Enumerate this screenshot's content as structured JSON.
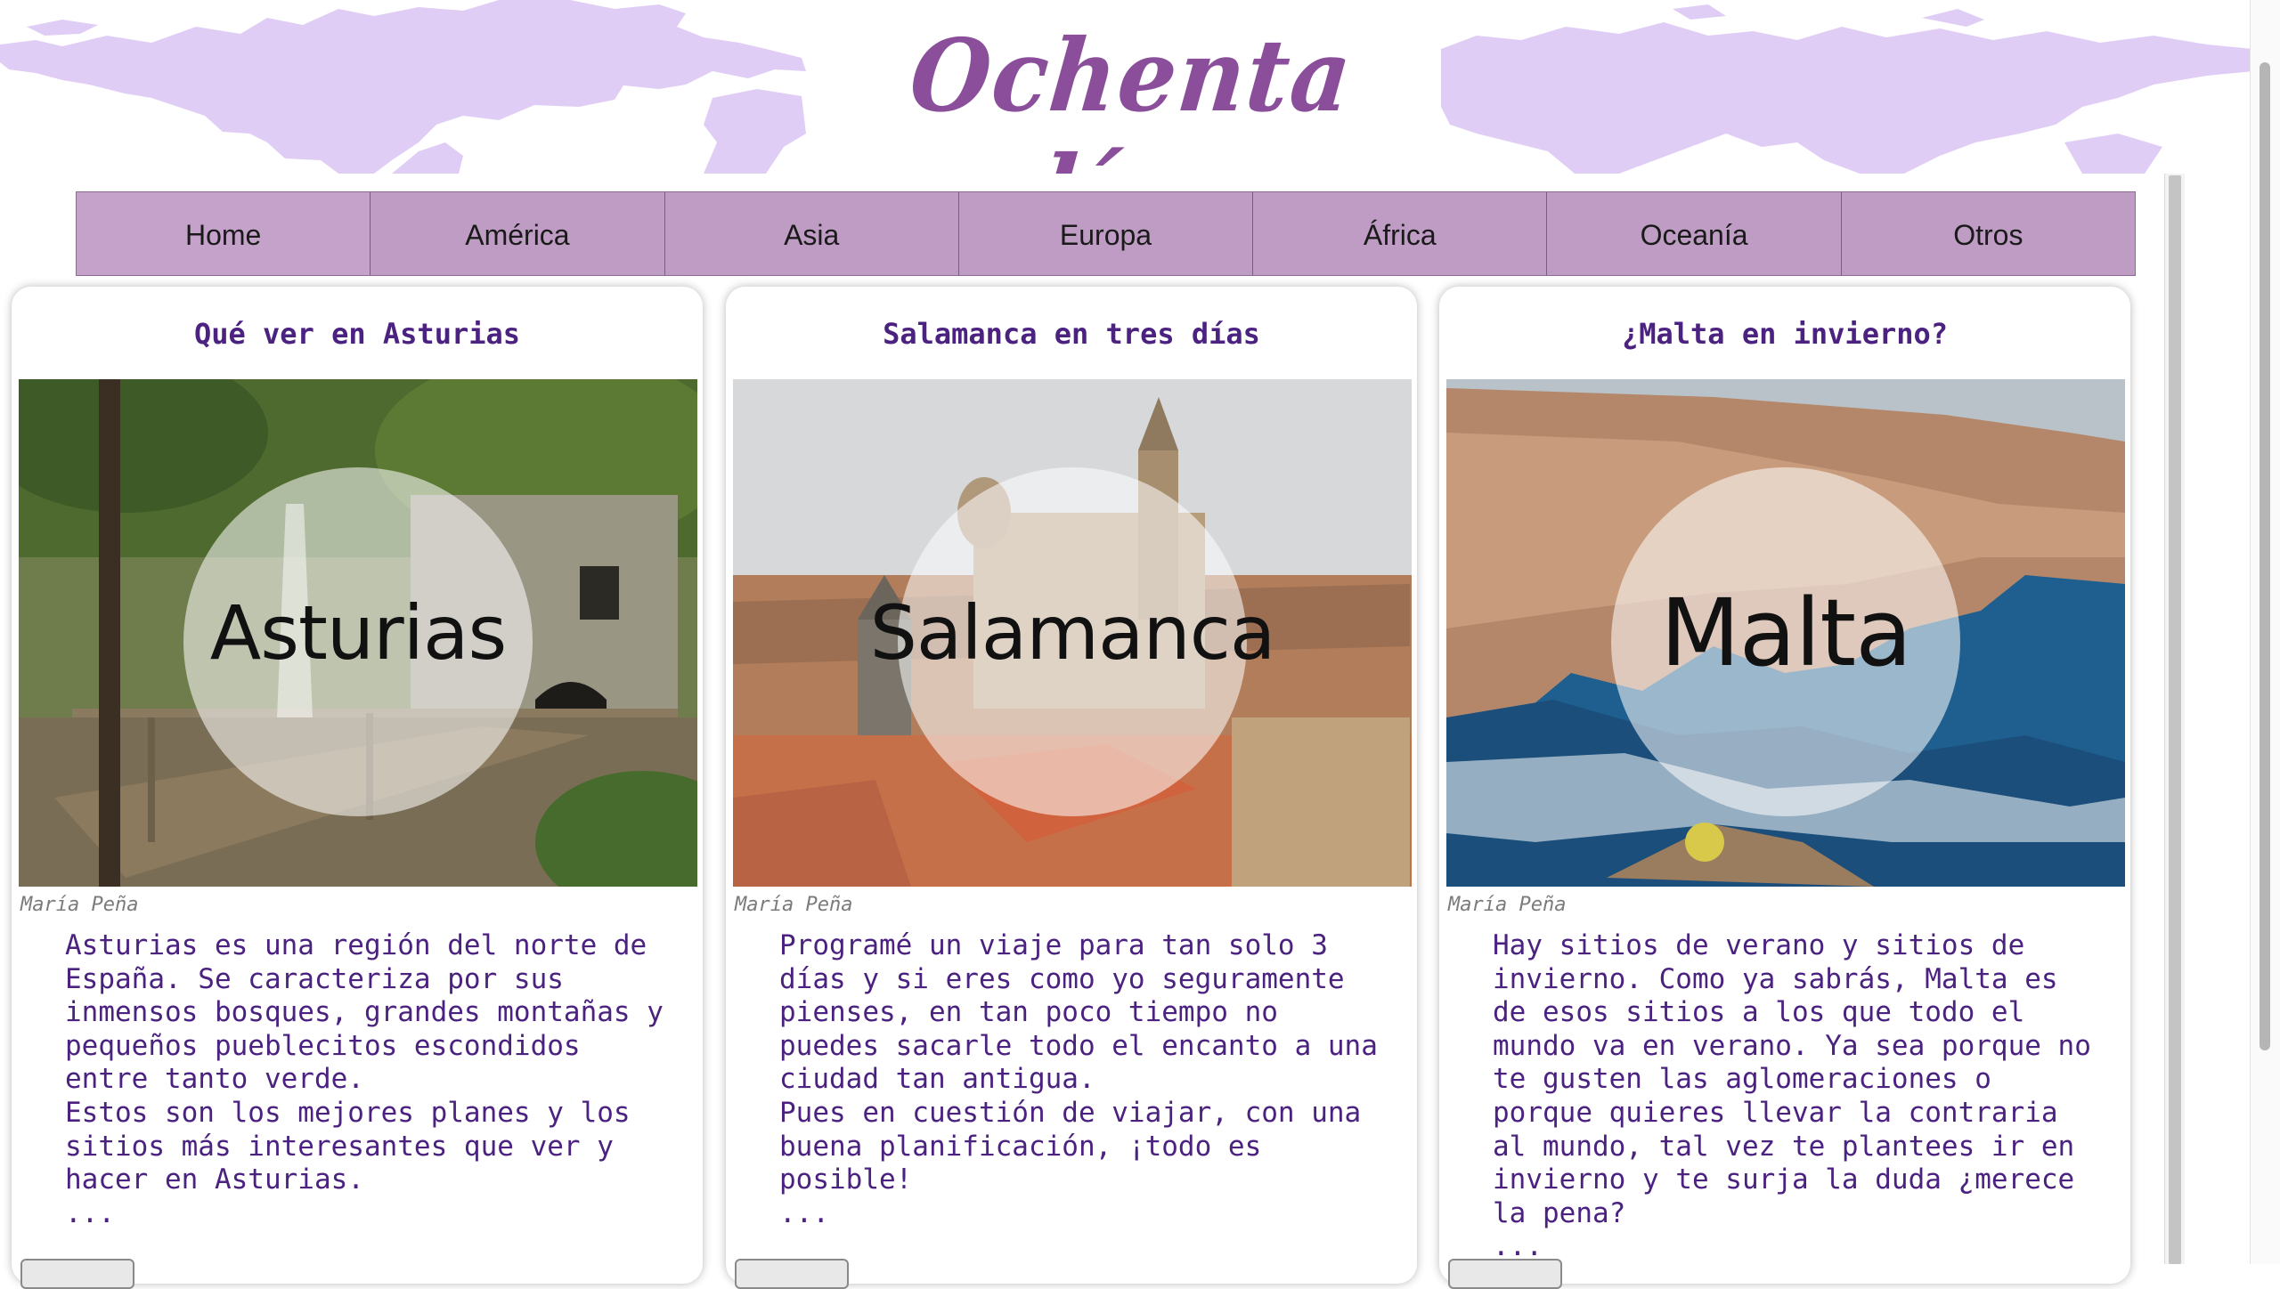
{
  "site": {
    "title": "Ochenta días",
    "accent_color": "#8a4e9a",
    "nav_color": "#bf9cc4",
    "text_color": "#4b2280"
  },
  "nav": {
    "items": [
      {
        "label": "Home"
      },
      {
        "label": "América"
      },
      {
        "label": "Asia"
      },
      {
        "label": "Europa"
      },
      {
        "label": "África"
      },
      {
        "label": "Oceanía"
      },
      {
        "label": "Otros"
      }
    ]
  },
  "cards": [
    {
      "title": "Qué ver en Asturias",
      "image_label": "Asturias",
      "credit": "María Peña",
      "text": "Asturias es una región del norte de\nEspaña. Se caracteriza por sus\ninmensos bosques, grandes montañas y\npequeños pueblecitos escondidos\nentre tanto verde.\nEstos son los mejores planes y los\nsitios más interesantes que ver y\nhacer en Asturias.\n..."
    },
    {
      "title": "Salamanca en tres días",
      "image_label": "Salamanca",
      "credit": "María Peña",
      "text": "Programé un viaje para tan solo 3\ndías y si eres como yo seguramente\npienses, en tan poco tiempo no\npuedes sacarle todo el encanto a una\nciudad tan antigua.\nPues en cuestión de viajar, con una\nbuena planificación, ¡todo es\nposible!\n..."
    },
    {
      "title": "¿Malta en invierno?",
      "image_label": "Malta",
      "credit": "María Peña",
      "text": "Hay sitios de verano y sitios de\ninvierno. Como ya sabrás, Malta es\nde esos sitios a los que todo el\nmundo va en verano. Ya sea porque no\nte gusten las aglomeraciones o\nporque quieres llevar la contraria\nal mundo, tal vez te plantees ir en\ninvierno y te surja la duda ¿merece\nla pena?\n..."
    }
  ]
}
